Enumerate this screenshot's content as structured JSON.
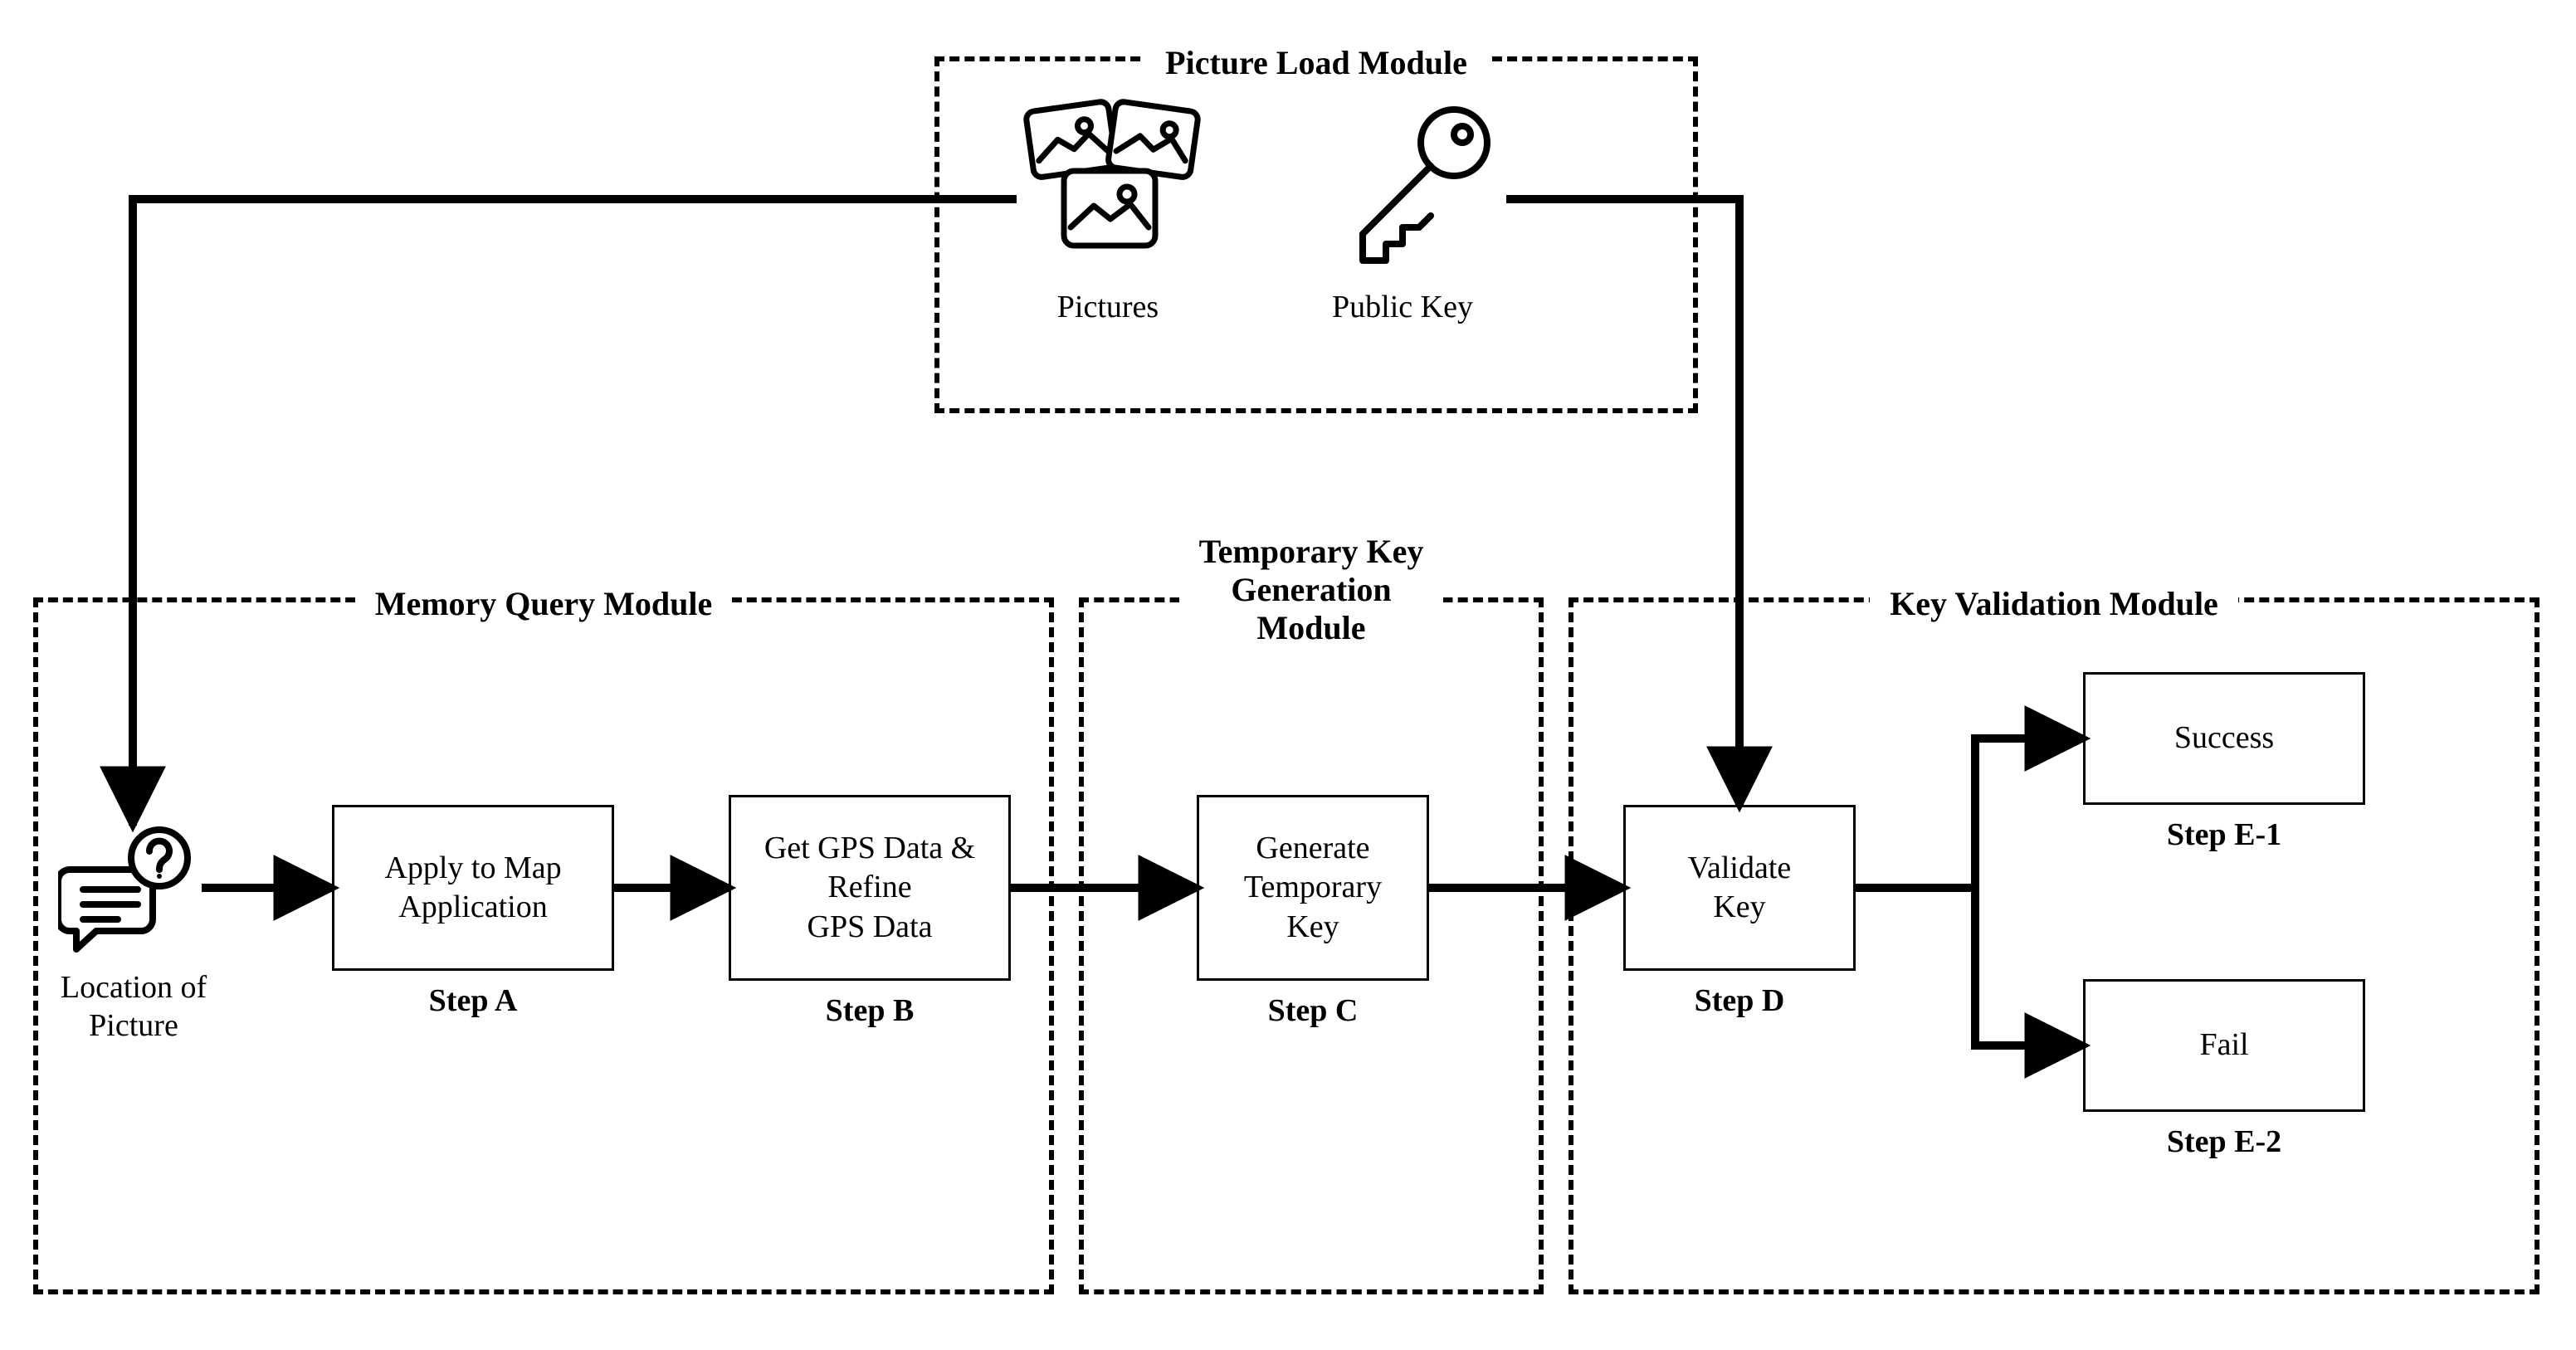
{
  "modules": {
    "picture_load": "Picture Load Module",
    "memory_query": "Memory Query Module",
    "temp_key": "Temporary Key\nGeneration\nModule",
    "key_validation": "Key Validation Module"
  },
  "icons": {
    "pictures_caption": "Pictures",
    "public_key_caption": "Public Key",
    "location_caption": "Location of\nPicture"
  },
  "steps": {
    "A": {
      "label": "Step A",
      "text": "Apply to Map\nApplication"
    },
    "B": {
      "label": "Step B",
      "text": "Get GPS Data &\nRefine\nGPS Data"
    },
    "C": {
      "label": "Step C",
      "text": "Generate\nTemporary\nKey"
    },
    "D": {
      "label": "Step D",
      "text": "Validate\nKey"
    },
    "E1": {
      "label": "Step E-1",
      "text": "Success"
    },
    "E2": {
      "label": "Step E-2",
      "text": "Fail"
    }
  }
}
